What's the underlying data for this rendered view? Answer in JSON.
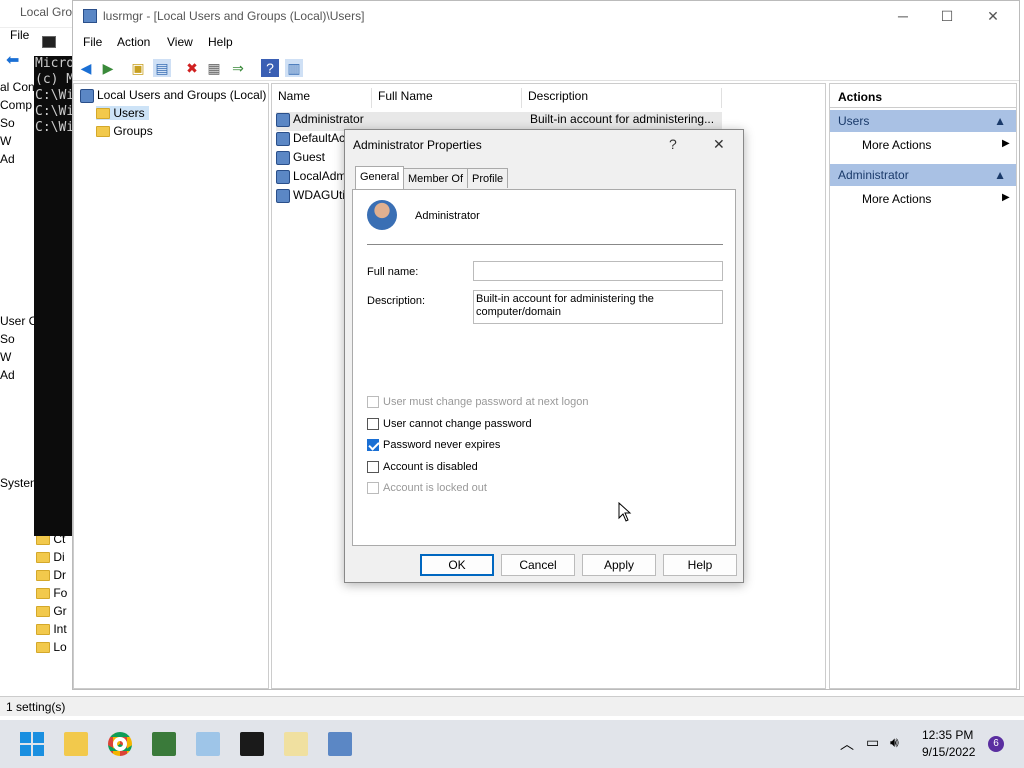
{
  "bg_window": {
    "title": "Local Gro",
    "menu_file": "File",
    "tree_items": [
      "al Con",
      "Comp",
      "So",
      "W",
      "Ad",
      "",
      "",
      "",
      "",
      "",
      "",
      "",
      "",
      "User C",
      "So",
      "W",
      "Ad",
      "",
      "",
      "",
      "",
      "",
      "Systen"
    ],
    "tree2_items": [
      "Ct",
      "Di",
      "Dr",
      "Fo",
      "Gr",
      "Int",
      "Lo"
    ],
    "status": "1 setting(s)"
  },
  "console": {
    "lines": [
      "Micro",
      "(c) M",
      "",
      "C:\\Wi",
      "",
      "C:\\Wi",
      "",
      "C:\\Wi"
    ]
  },
  "window": {
    "title": "lusrmgr - [Local Users and Groups (Local)\\Users]",
    "menu": [
      "File",
      "Action",
      "View",
      "Help"
    ]
  },
  "tree": {
    "root": "Local Users and Groups (Local)",
    "items": [
      "Users",
      "Groups"
    ]
  },
  "list": {
    "columns": [
      "Name",
      "Full Name",
      "Description"
    ],
    "rows": [
      {
        "name": "Administrator",
        "full_name": "",
        "description": "Built-in account for administering..."
      },
      {
        "name": "DefaultAc",
        "full_name": "",
        "description": ""
      },
      {
        "name": "Guest",
        "full_name": "",
        "description": ""
      },
      {
        "name": "LocalAdm",
        "full_name": "",
        "description": ""
      },
      {
        "name": "WDAGUti",
        "full_name": "",
        "description": ""
      }
    ]
  },
  "actions": {
    "title": "Actions",
    "sections": [
      {
        "header": "Users",
        "item": "More Actions"
      },
      {
        "header": "Administrator",
        "item": "More Actions"
      }
    ]
  },
  "dialog": {
    "title": "Administrator Properties",
    "help_glyph": "?",
    "close_glyph": "✕",
    "tabs": [
      "General",
      "Member Of",
      "Profile"
    ],
    "user_name": "Administrator",
    "full_name_label": "Full name:",
    "full_name_value": "",
    "description_label": "Description:",
    "description_value": "Built-in account for administering the computer/domain",
    "checkboxes": [
      {
        "label": "User must change password at next logon",
        "checked": false,
        "disabled": true
      },
      {
        "label": "User cannot change password",
        "checked": false,
        "disabled": false
      },
      {
        "label": "Password never expires",
        "checked": true,
        "disabled": false
      },
      {
        "label": "Account is disabled",
        "checked": false,
        "disabled": false
      },
      {
        "label": "Account is locked out",
        "checked": false,
        "disabled": true
      }
    ],
    "buttons": [
      "OK",
      "Cancel",
      "Apply",
      "Help"
    ]
  },
  "taskbar": {
    "time": "12:35 PM",
    "date": "9/15/2022",
    "notification_count": "6"
  },
  "colors": {
    "accent": "#0067c0",
    "action_header": "#a9c1e4"
  }
}
